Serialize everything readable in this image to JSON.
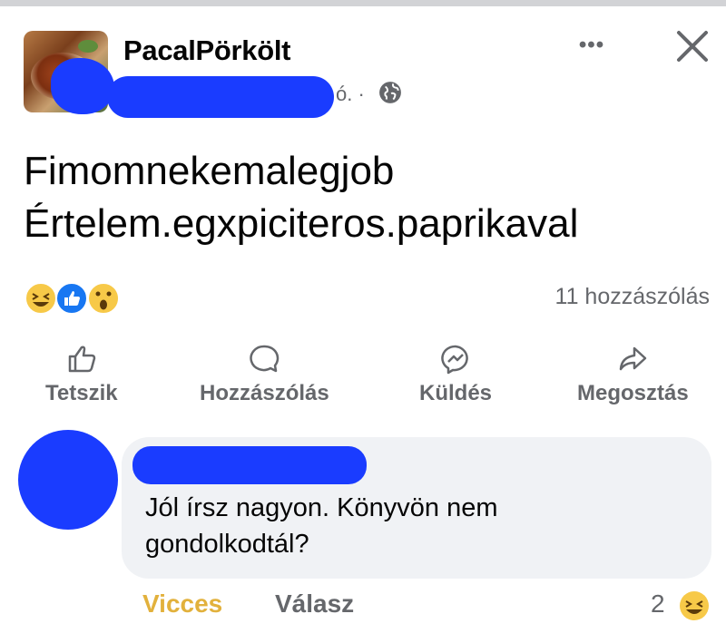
{
  "post": {
    "author": "PacalPörkölt",
    "time_fragment": "ó. ·",
    "text_line1": "Fimomnekemalegjob",
    "text_line2": "Értelem.egxpiciteros.paprikaval",
    "reactions": [
      "haha-icon",
      "like-icon",
      "wow-icon"
    ],
    "comments_count": "11 hozzászólás"
  },
  "header": {
    "more_label": "•••",
    "close_icon": "close-icon"
  },
  "actions": {
    "like": "Tetszik",
    "comment": "Hozzászólás",
    "send": "Küldés",
    "share": "Megosztás"
  },
  "comment": {
    "text": "Jól írsz nagyon. Könyvön nem gondolkodtál?",
    "reaction_label": "Vicces",
    "reply_label": "Válasz",
    "reaction_count": "2"
  },
  "colors": {
    "accent_funny": "#e2b13c",
    "muted": "#65676b",
    "bubble": "#f0f2f5",
    "like_blue": "#1877f2",
    "redaction": "#1a3cff"
  }
}
